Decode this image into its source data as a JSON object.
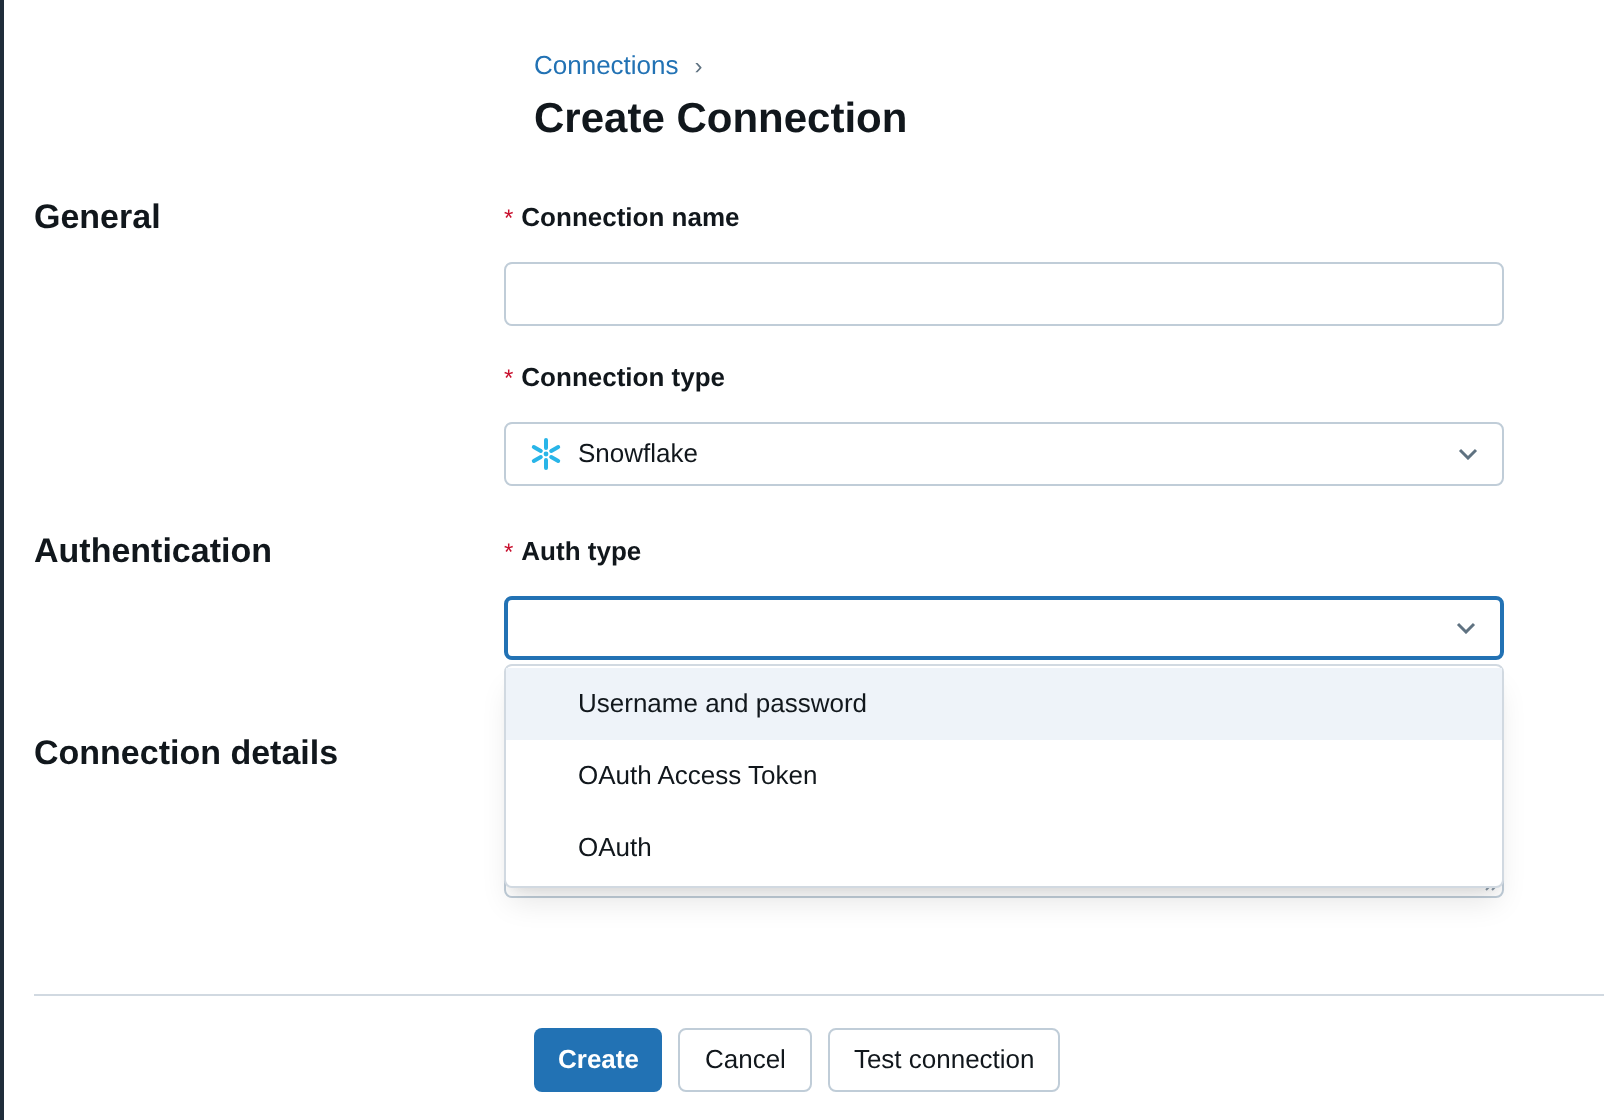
{
  "breadcrumb": {
    "link": "Connections",
    "separator": "›"
  },
  "title": "Create Connection",
  "sections": [
    {
      "title": "General",
      "fields": [
        {
          "kind": "text",
          "required_mark": "*",
          "label": "Connection name"
        },
        {
          "kind": "select",
          "required_mark": "*",
          "label": "Connection type",
          "value": {
            "text": "Snowflake",
            "kind": "snowflake"
          },
          "open": false
        }
      ]
    },
    {
      "title": "Authentication",
      "fields": [
        {
          "kind": "select",
          "required_mark": "*",
          "label": "Auth type",
          "open": true,
          "options": [
            {
              "label": "Username and password",
              "selected": true
            },
            {
              "label": "OAuth Access Token",
              "selected": false
            },
            {
              "label": "OAuth",
              "selected": false
            }
          ]
        }
      ]
    },
    {
      "title": "Connection details",
      "fields": [
        {
          "kind": "textarea"
        }
      ]
    }
  ],
  "buttons": [
    {
      "label": "Create",
      "kind": "primary"
    },
    {
      "label": "Cancel",
      "kind": "secondary"
    },
    {
      "label": "Test connection",
      "kind": "secondary"
    }
  ]
}
